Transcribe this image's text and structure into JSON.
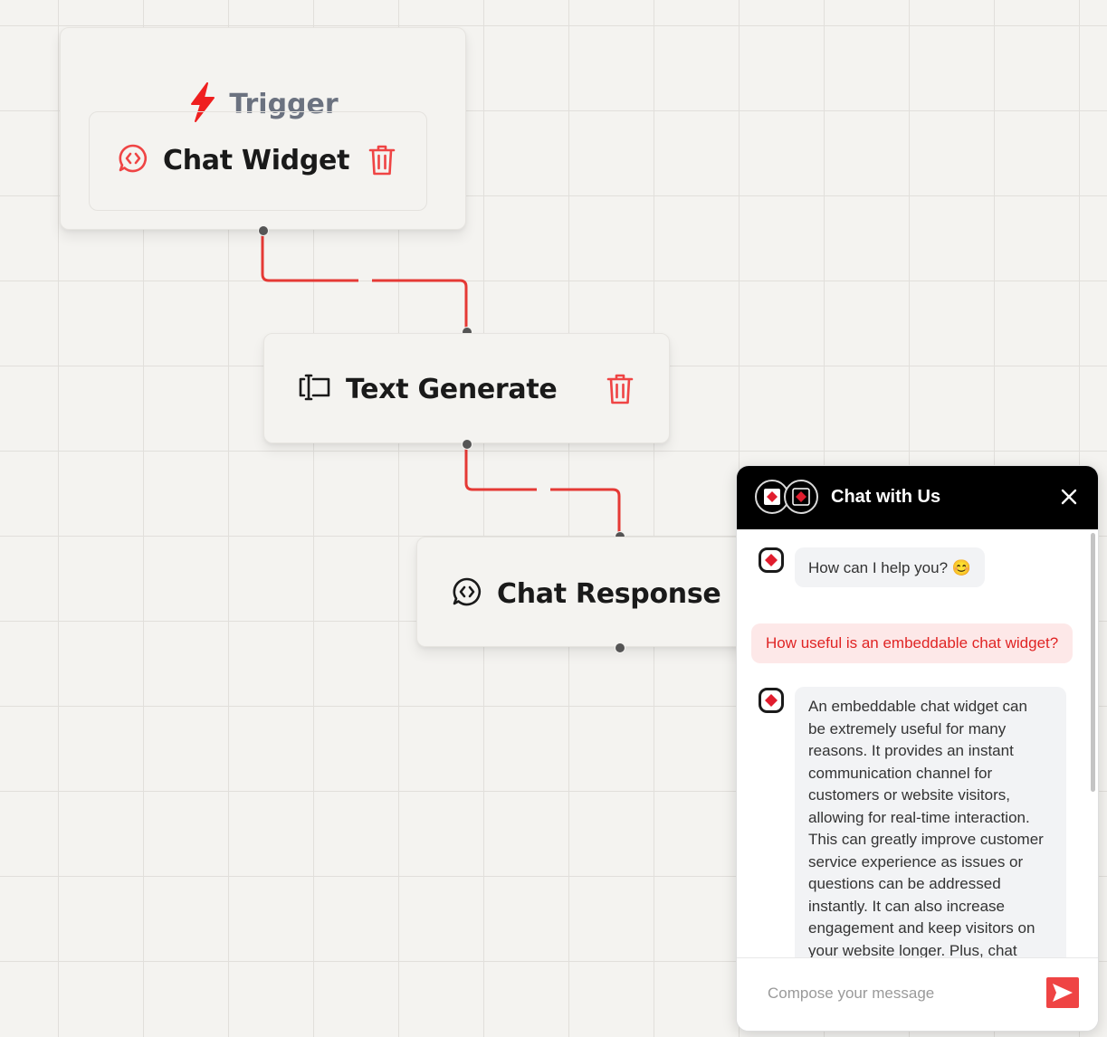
{
  "canvas": {
    "nodes": {
      "trigger": {
        "heading": "Trigger",
        "heading_icon": "lightning-bolt-icon",
        "item_label": "Chat Widget",
        "item_icon": "chat-code-bubble-icon"
      },
      "text_generate": {
        "label": "Text Generate",
        "icon": "text-cursor-icon"
      },
      "chat_response": {
        "label": "Chat Response",
        "icon": "chat-code-bubble-icon"
      }
    },
    "delete_icon": "trash-icon",
    "colors": {
      "accent": "#ef4444",
      "wire": "#e53935",
      "canvas_bg": "#f4f3f0",
      "grid": "#e1dfdb"
    }
  },
  "chat_widget": {
    "title": "Chat with Us",
    "close_icon": "close-icon",
    "messages": [
      {
        "role": "bot",
        "text": "How can I help you? 😊"
      },
      {
        "role": "user",
        "text": "How useful is an embeddable chat widget?"
      },
      {
        "role": "bot",
        "lines": [
          "An embeddable chat widget can",
          "be extremely useful for many",
          "reasons. It provides an instant",
          "communication channel for",
          "customers or website visitors,",
          "allowing for real-time interaction.",
          "This can greatly improve customer",
          "service experience as issues or",
          "questions can be addressed",
          "instantly. It can also increase",
          "engagement and keep visitors on",
          "your website longer. Plus, chat"
        ]
      }
    ],
    "input_placeholder": "Compose your message",
    "send_icon": "send-arrow-icon"
  }
}
